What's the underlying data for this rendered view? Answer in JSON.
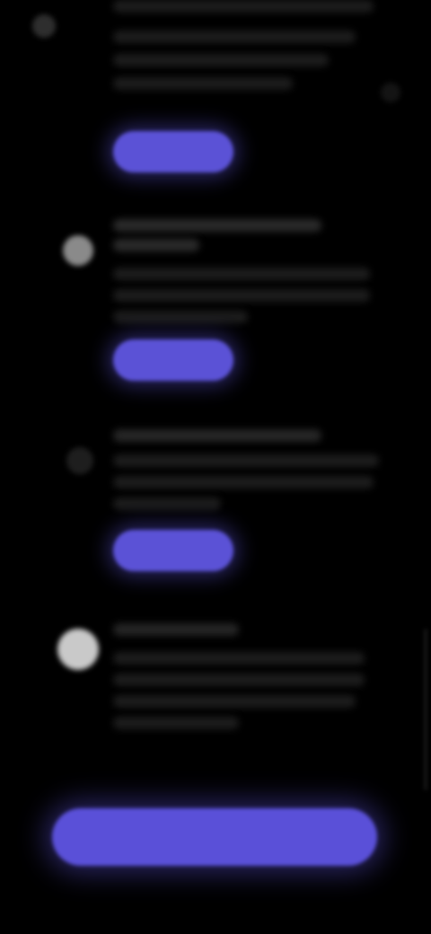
{
  "steps": [
    {
      "title": "",
      "description": "",
      "button_label": ""
    },
    {
      "title": "",
      "description": "",
      "button_label": ""
    },
    {
      "title": "",
      "description": "",
      "button_label": ""
    },
    {
      "title": "",
      "description": ""
    }
  ],
  "primary_action": {
    "label": ""
  },
  "colors": {
    "background": "#000000",
    "accent": "#5b52d6",
    "icon_active": "#c9c9c9",
    "icon_inactive": "#3a3a3a"
  }
}
